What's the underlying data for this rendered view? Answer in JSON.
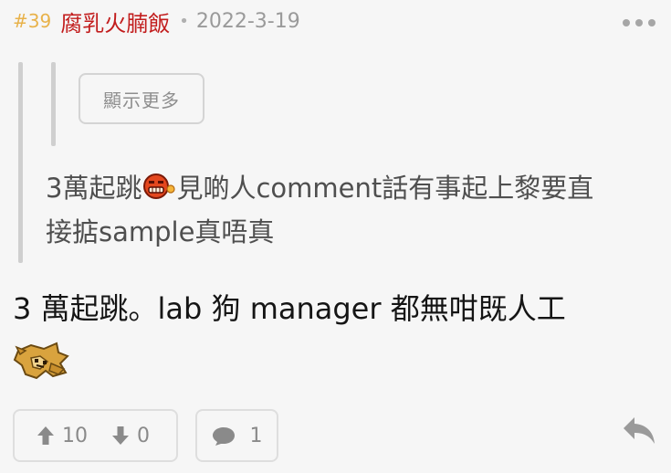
{
  "post": {
    "number": "#39",
    "username": "腐乳火腩飯",
    "separator": "•",
    "date": "2022-3-19"
  },
  "quote": {
    "show_more_label": "顯示更多",
    "line1_before": "3萬起跳",
    "line1_after": "見啲人comment話有事起上黎要直",
    "line2": "接掂sample真唔真"
  },
  "body": {
    "text": "3 萬起跳。lab 狗 manager 都無咁既人工"
  },
  "actions": {
    "upvotes": "10",
    "downvotes": "0",
    "replies": "1"
  },
  "icons": {
    "more": "more-dots-icon",
    "angry_emoji": "angry-face-icon",
    "dog_sticker": "crying-dog-sticker",
    "thumbs_up": "thumb-up-icon",
    "thumbs_down": "thumb-down-icon",
    "reply_count": "speech-bubble-icon",
    "reply": "reply-arrow-icon"
  },
  "colors": {
    "post_number": "#e8b24a",
    "username": "#c21d1d",
    "muted_text": "#9a9a9a",
    "body_text": "#151515",
    "quote_text": "#4f4f4f"
  }
}
